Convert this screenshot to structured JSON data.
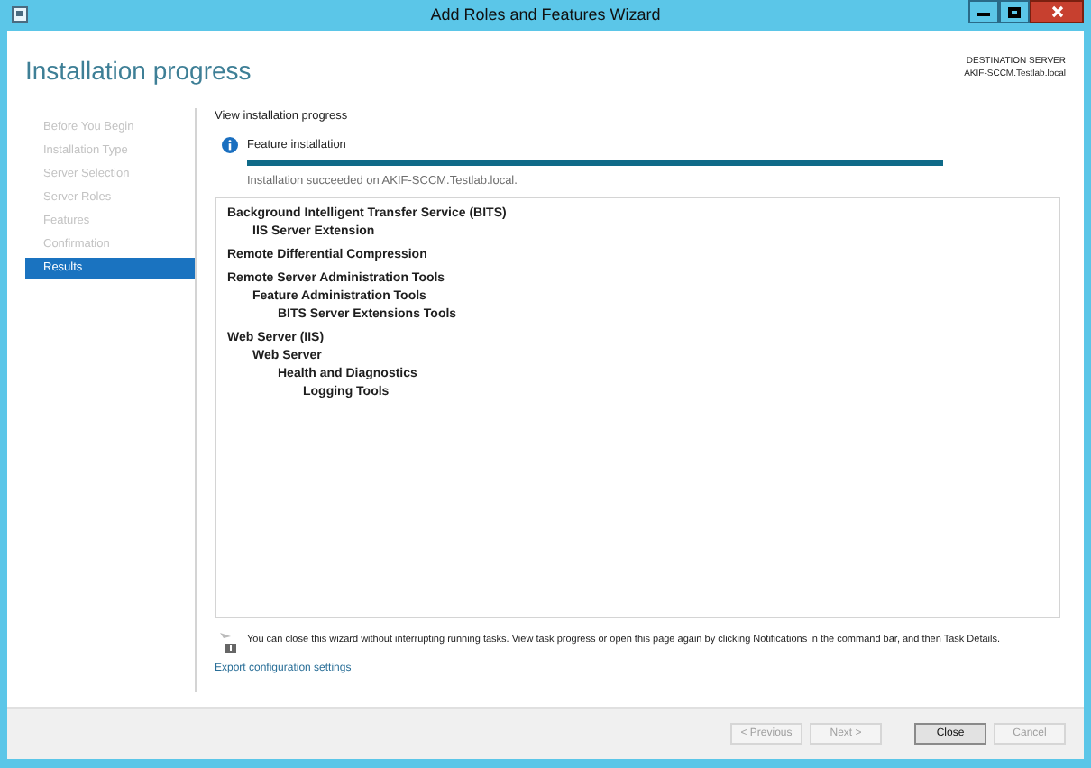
{
  "window": {
    "title": "Add Roles and Features Wizard"
  },
  "header": {
    "title": "Installation progress",
    "destination_label": "DESTINATION SERVER",
    "destination_server": "AKIF-SCCM.Testlab.local"
  },
  "sidebar": {
    "items": [
      {
        "label": "Before You Begin",
        "selected": false
      },
      {
        "label": "Installation Type",
        "selected": false
      },
      {
        "label": "Server Selection",
        "selected": false
      },
      {
        "label": "Server Roles",
        "selected": false
      },
      {
        "label": "Features",
        "selected": false
      },
      {
        "label": "Confirmation",
        "selected": false
      },
      {
        "label": "Results",
        "selected": true
      }
    ]
  },
  "main": {
    "heading": "View installation progress",
    "status_title": "Feature installation",
    "progress": {
      "level": 1
    },
    "status_message": "Installation succeeded on AKIF-SCCM.Testlab.local.",
    "features": [
      {
        "label": "Background Intelligent Transfer Service (BITS)",
        "children": [
          {
            "label": "IIS Server Extension"
          }
        ]
      },
      {
        "label": "Remote Differential Compression"
      },
      {
        "label": "Remote Server Administration Tools",
        "children": [
          {
            "label": "Feature Administration Tools",
            "children": [
              {
                "label": "BITS Server Extensions Tools"
              }
            ]
          }
        ]
      },
      {
        "label": "Web Server (IIS)",
        "children": [
          {
            "label": "Web Server",
            "children": [
              {
                "label": "Health and Diagnostics",
                "children": [
                  {
                    "label": "Logging Tools"
                  }
                ]
              }
            ]
          }
        ]
      }
    ],
    "notice": "You can close this wizard without interrupting running tasks. View task progress or open this page again by clicking Notifications in the command bar, and then Task Details.",
    "export_link": "Export configuration settings"
  },
  "buttons": [
    {
      "label": "< Previous",
      "disabled": true
    },
    {
      "label": "Next >",
      "disabled": true
    },
    {
      "label": "Close",
      "disabled": false
    },
    {
      "label": "Cancel",
      "disabled": true
    }
  ]
}
